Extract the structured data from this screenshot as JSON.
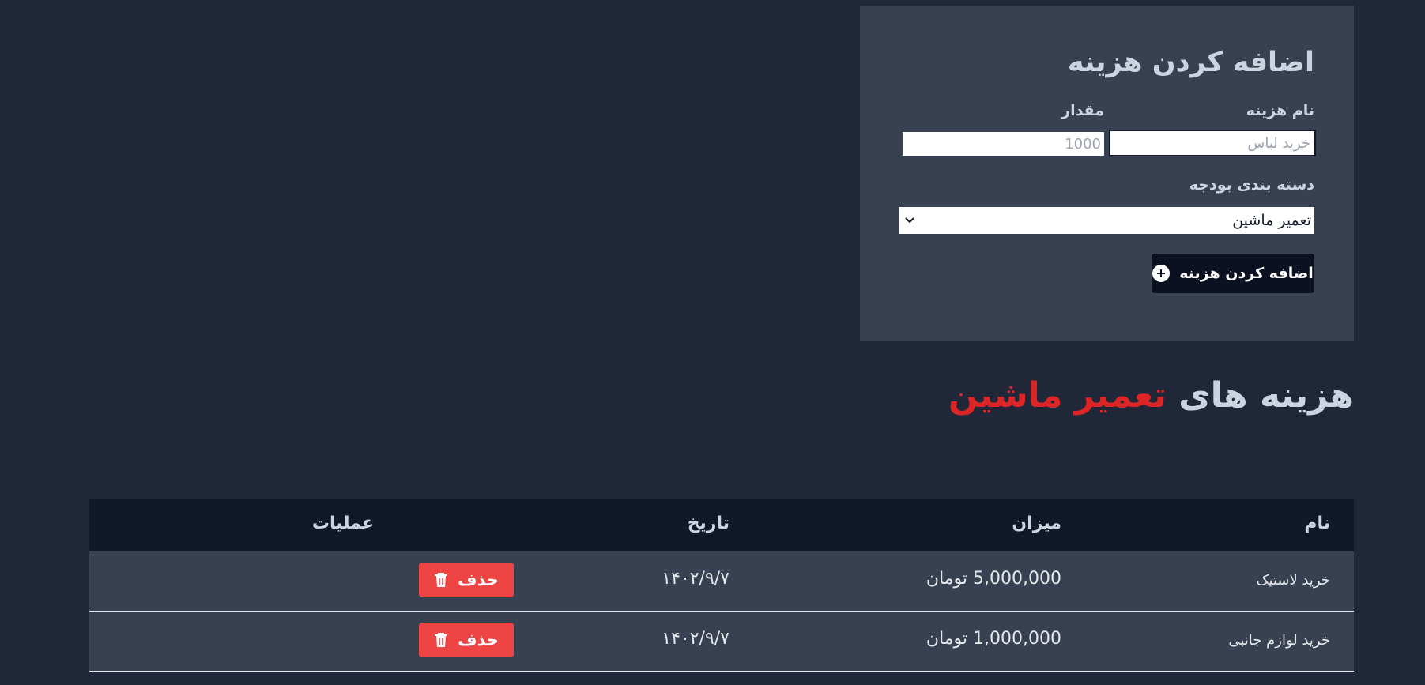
{
  "form": {
    "title": "اضافه کردن هزینه",
    "name_label": "نام هزینه",
    "name_placeholder": "خرید لباس",
    "amount_label": "مقدار",
    "amount_placeholder": "1000",
    "category_label": "دسته بندی بودجه",
    "category_selected": "تعمیر ماشین",
    "add_button_label": "اضافه کردن هزینه"
  },
  "section": {
    "heading_prefix": "هزینه های",
    "heading_category": "تعمیر ماشین"
  },
  "table": {
    "headers": {
      "name": "نام",
      "amount": "میزان",
      "date": "تاریخ",
      "actions": "عملیات"
    },
    "rows": [
      {
        "name": "خرید لاستیک",
        "amount": "5,000,000 تومان",
        "date": "۱۴۰۲/۹/۷",
        "delete_label": "حذف"
      },
      {
        "name": "خرید لوازم جانبی",
        "amount": "1,000,000 تومان",
        "date": "۱۴۰۲/۹/۷",
        "delete_label": "حذف"
      }
    ]
  },
  "colors": {
    "background": "#1f2738",
    "card": "#374151",
    "table_header": "#111827",
    "accent_red": "#dc2626",
    "delete_button": "#ef4444",
    "add_button": "#0b1120"
  }
}
